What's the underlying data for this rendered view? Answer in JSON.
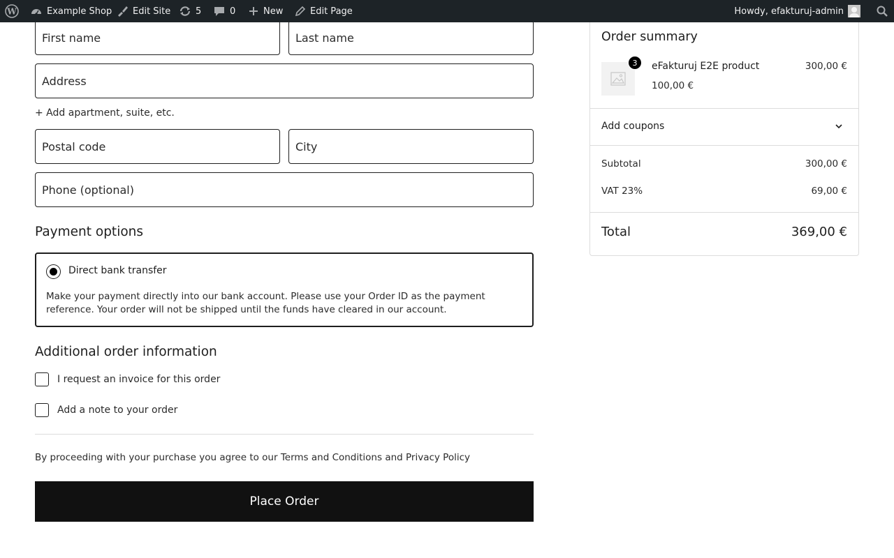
{
  "adminbar": {
    "site_name": "Example Shop",
    "edit_site": "Edit Site",
    "updates_count": "5",
    "comments_count": "0",
    "new_label": "New",
    "edit_page": "Edit Page",
    "howdy": "Howdy, efakturuj-admin"
  },
  "form": {
    "first_name_placeholder": "First name",
    "last_name_placeholder": "Last name",
    "address_placeholder": "Address",
    "add_apartment_link": "+ Add apartment, suite, etc.",
    "postal_code_placeholder": "Postal code",
    "city_placeholder": "City",
    "phone_placeholder": "Phone (optional)"
  },
  "payment": {
    "heading": "Payment options",
    "method_label": "Direct bank transfer",
    "method_description": "Make your payment directly into our bank account. Please use your Order ID as the payment reference. Your order will not be shipped until the funds have cleared in our account."
  },
  "additional": {
    "heading": "Additional order information",
    "invoice_label": "I request an invoice for this order",
    "note_label": "Add a note to your order"
  },
  "terms_text": "By proceeding with your purchase you agree to our Terms and Conditions and Privacy Policy",
  "place_order_label": "Place Order",
  "summary": {
    "title": "Order summary",
    "product": {
      "quantity": "3",
      "name": "eFakturuj E2E product",
      "unit_price": "100,00 €",
      "line_total": "300,00 €"
    },
    "coupons_label": "Add coupons",
    "subtotal_label": "Subtotal",
    "subtotal_value": "300,00 €",
    "vat_label": "VAT 23%",
    "vat_value": "69,00 €",
    "total_label": "Total",
    "total_value": "369,00 €"
  },
  "colors": {
    "adminbar_bg": "#1d2327",
    "button_bg": "#111111",
    "border": "#1e1e1e"
  }
}
